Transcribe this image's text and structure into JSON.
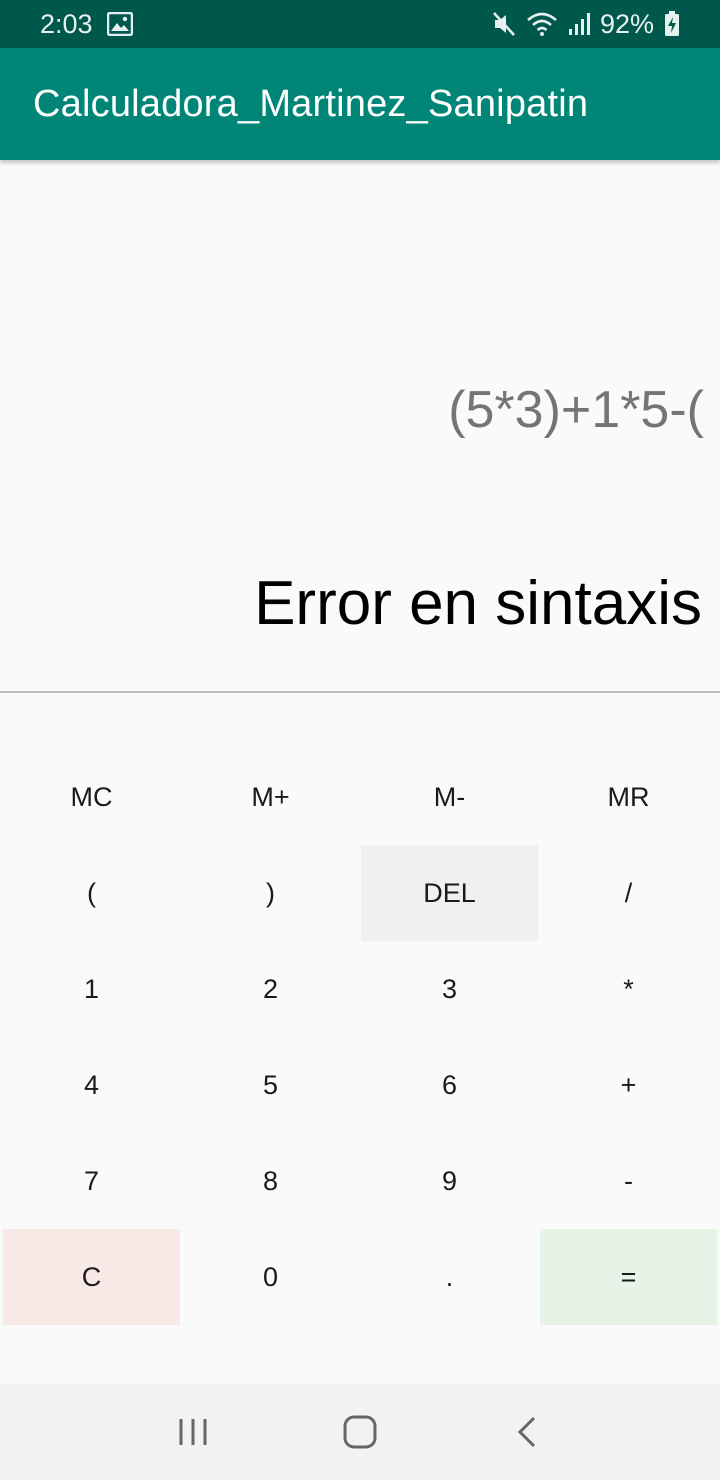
{
  "status_bar": {
    "time": "2:03",
    "battery": "92%",
    "icons": [
      "gallery-icon",
      "mute-icon",
      "wifi-icon",
      "signal-icon",
      "battery-charging-icon"
    ]
  },
  "app_bar": {
    "title": "Calculadora_Martinez_Sanipatin",
    "color": "#008577"
  },
  "display": {
    "expression": "(5*3)+1*5-(",
    "result": "Error en sintaxis"
  },
  "keypad": {
    "keys": [
      {
        "label": "MC"
      },
      {
        "label": "M+"
      },
      {
        "label": "M-"
      },
      {
        "label": "MR"
      },
      {
        "label": "("
      },
      {
        "label": ")"
      },
      {
        "label": "DEL"
      },
      {
        "label": "/"
      },
      {
        "label": "1"
      },
      {
        "label": "2"
      },
      {
        "label": "3"
      },
      {
        "label": "*"
      },
      {
        "label": "4"
      },
      {
        "label": "5"
      },
      {
        "label": "6"
      },
      {
        "label": "+"
      },
      {
        "label": "7"
      },
      {
        "label": "8"
      },
      {
        "label": "9"
      },
      {
        "label": "-"
      },
      {
        "label": "C"
      },
      {
        "label": "0"
      },
      {
        "label": "."
      },
      {
        "label": "="
      }
    ]
  },
  "nav_bar": {
    "icons": [
      "recent-apps-icon",
      "home-icon",
      "back-icon"
    ]
  }
}
